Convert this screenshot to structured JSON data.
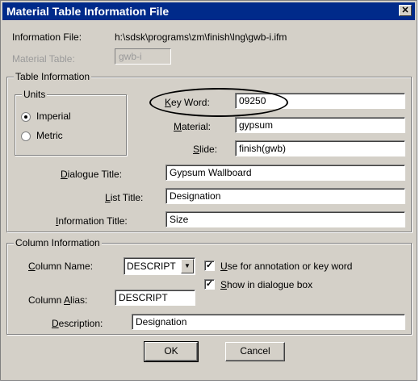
{
  "window": {
    "title": "Material Table Information File",
    "close_glyph": "✕"
  },
  "info_file": {
    "label": "Information File:",
    "value": "h:\\sdsk\\programs\\zm\\finish\\lng\\gwb-i.ifm"
  },
  "material_table": {
    "label": "Material Table:",
    "value": "gwb-i"
  },
  "table_info": {
    "group_label": "Table Information",
    "units": {
      "group_label": "Units",
      "imperial": "Imperial",
      "metric": "Metric",
      "selected": "Imperial"
    },
    "key_word": {
      "label_u": "K",
      "label_rest": "ey Word:",
      "value": "09250"
    },
    "material": {
      "label_u": "M",
      "label_rest": "aterial:",
      "value": "gypsum"
    },
    "slide": {
      "label_u": "S",
      "label_rest": "lide:",
      "value": "finish(gwb)"
    },
    "dialogue_title": {
      "label_u": "D",
      "label_rest": "ialogue Title:",
      "value": "Gypsum Wallboard"
    },
    "list_title": {
      "label_pre": "",
      "label_u": "L",
      "label_rest": "ist Title:",
      "value": "Designation"
    },
    "information_title": {
      "label_u": "I",
      "label_rest": "nformation Title:",
      "value": "Size"
    }
  },
  "column_info": {
    "group_label": "Column Information",
    "column_name": {
      "label_u": "C",
      "label_rest": "olumn Name:",
      "value": "DESCRIPT"
    },
    "use_for_annotation": {
      "label_u": "U",
      "label_rest": "se for annotation or key word",
      "checked": true
    },
    "show_in_dialogue": {
      "label_u": "S",
      "label_rest": "how in dialogue box",
      "checked": true
    },
    "column_alias": {
      "label_pre": "Column ",
      "label_u": "A",
      "label_rest": "lias:",
      "value": "DESCRIPT"
    },
    "description": {
      "label_u": "D",
      "label_rest": "escription:",
      "value": "Designation"
    }
  },
  "buttons": {
    "ok": "OK",
    "cancel": "Cancel"
  },
  "check_glyph": "✓"
}
